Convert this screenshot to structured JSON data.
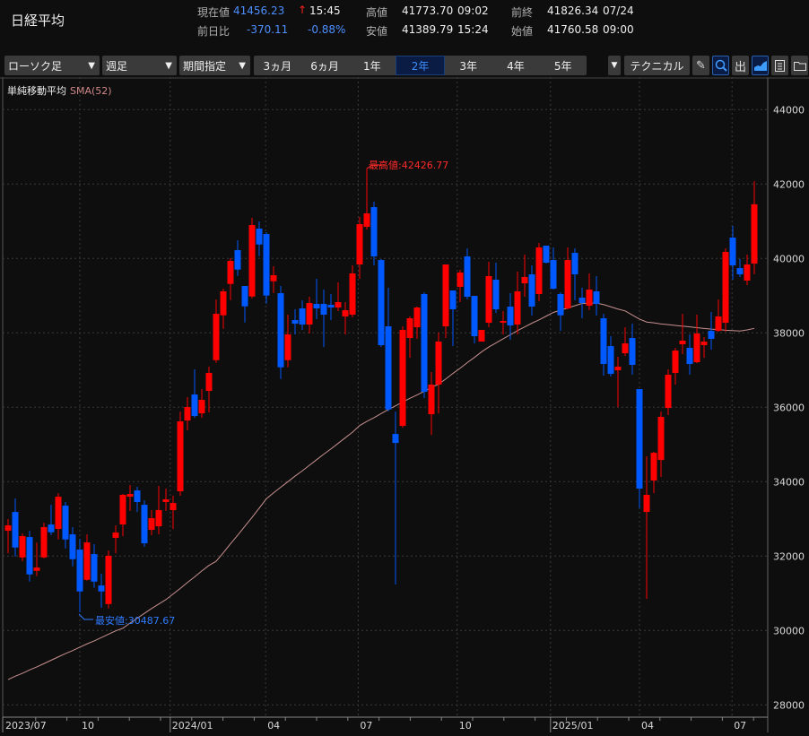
{
  "header": {
    "title": "日経平均",
    "current_label": "現在値",
    "current_value": "41456.23",
    "current_arrow": "↑",
    "current_time": "15:45",
    "high_label": "高値",
    "high_value": "41773.70",
    "high_time": "09:02",
    "prev_close_label": "前終",
    "prev_close_value": "41826.34",
    "prev_close_date": "07/24",
    "change_label": "前日比",
    "change_value": "-370.11",
    "change_pct": "-0.88%",
    "low_label": "安値",
    "low_value": "41389.79",
    "low_time": "15:24",
    "open_label": "始値",
    "open_value": "41760.58",
    "open_time": "09:00"
  },
  "toolbar": {
    "chart_type": "ローソク足",
    "interval": "週足",
    "period_mode": "期間指定",
    "periods": [
      "3ヵ月",
      "6ヵ月",
      "1年",
      "2年",
      "3年",
      "4年",
      "5年"
    ],
    "selected_period": "2年",
    "technical_label": "テクニカル",
    "icons": [
      "pencil-icon",
      "zoom-icon",
      "volume-icon",
      "area-chart-icon",
      "save-icon",
      "folder-icon"
    ]
  },
  "legend": {
    "indicator": "単純移動平均",
    "series": "SMA(52)"
  },
  "colors": {
    "up": "#ff0000",
    "down": "#0058ff",
    "sma": "#c89090",
    "accent": "#3f8cff",
    "background": "#0e0e0e"
  },
  "chart_data": {
    "type": "candlestick",
    "interval": "weekly",
    "y_ticks": [
      28000,
      30000,
      32000,
      34000,
      36000,
      38000,
      40000,
      42000,
      44000
    ],
    "ylim": [
      27600,
      45300
    ],
    "x_tick_labels": [
      "2023/07",
      "10",
      "2024/01",
      "04",
      "07",
      "10",
      "2025/01",
      "04",
      "07"
    ],
    "grid": true,
    "annotations": {
      "high": "最高値:42426.77",
      "low": "最安値:30487.67"
    },
    "ohlc_columns": [
      "open",
      "high",
      "low",
      "close"
    ],
    "candles": [
      [
        32680,
        32994,
        32078,
        32825
      ],
      [
        33186,
        33548,
        31989,
        32230
      ],
      [
        31964,
        32608,
        31861,
        32536
      ],
      [
        32512,
        32680,
        31314,
        31507
      ],
      [
        31603,
        32367,
        31458,
        31692
      ],
      [
        31964,
        32897,
        31940,
        32777
      ],
      [
        32849,
        33379,
        32567,
        32640
      ],
      [
        32729,
        33693,
        32447,
        33596
      ],
      [
        33355,
        33452,
        32206,
        32447
      ],
      [
        32584,
        32777,
        31723,
        31916
      ],
      [
        32174,
        32463,
        30487.67,
        31049
      ],
      [
        31362,
        32584,
        31340,
        32367
      ],
      [
        32054,
        32319,
        31145,
        31314
      ],
      [
        31210,
        31523,
        30615,
        31049
      ],
      [
        30711,
        32151,
        30591,
        32006
      ],
      [
        32488,
        32825,
        32078,
        32632
      ],
      [
        32849,
        33669,
        32536,
        33645
      ],
      [
        33596,
        33910,
        33211,
        33669
      ],
      [
        33765,
        33862,
        33186,
        33452
      ],
      [
        33379,
        33500,
        32247,
        32343
      ],
      [
        32705,
        33235,
        32560,
        33018
      ],
      [
        32801,
        33886,
        32584,
        33235
      ],
      [
        33452,
        33813,
        33211,
        33524
      ],
      [
        33235,
        33621,
        32729,
        33427
      ],
      [
        33741,
        35885,
        33621,
        35620
      ],
      [
        35644,
        36271,
        35379,
        36006
      ],
      [
        36343,
        37018,
        35716,
        35765
      ],
      [
        35837,
        36488,
        35716,
        36199
      ],
      [
        36440,
        37091,
        35861,
        36922
      ],
      [
        37266,
        38898,
        37194,
        38512
      ],
      [
        38472,
        39187,
        38110,
        39115
      ],
      [
        39315,
        40007,
        38881,
        39934
      ],
      [
        40224,
        40489,
        39532,
        39701
      ],
      [
        39260,
        39260,
        38279,
        38713
      ],
      [
        38978,
        41091,
        38930,
        40898
      ],
      [
        40802,
        40995,
        40062,
        40375
      ],
      [
        40657,
        40705,
        38785,
        39002
      ],
      [
        39387,
        39790,
        39074,
        39549
      ],
      [
        39067,
        39260,
        36760,
        37074
      ],
      [
        37266,
        38488,
        37074,
        37958
      ],
      [
        38344,
        38633,
        37958,
        38247
      ],
      [
        38657,
        38874,
        38079,
        38223
      ],
      [
        38223,
        38970,
        37982,
        38802
      ],
      [
        38778,
        39452,
        38368,
        38657
      ],
      [
        38778,
        39163,
        37620,
        38488
      ],
      [
        38754,
        39043,
        38344,
        38681
      ],
      [
        38681,
        39356,
        38585,
        38826
      ],
      [
        38440,
        38826,
        37958,
        38609
      ],
      [
        38488,
        39813,
        38416,
        39597
      ],
      [
        39838,
        41115,
        39452,
        40922
      ],
      [
        40850,
        42426.77,
        40778,
        41212
      ],
      [
        41380,
        41525,
        39814,
        40055
      ],
      [
        39958,
        39983,
        37620,
        37669
      ],
      [
        38175,
        39211,
        35893,
        35941
      ],
      [
        35282,
        35885,
        31240,
        35041
      ],
      [
        35500,
        38175,
        35450,
        38079
      ],
      [
        37862,
        38440,
        37331,
        38392
      ],
      [
        38151,
        38705,
        37838,
        38681
      ],
      [
        39043,
        39091,
        36247,
        36416
      ],
      [
        35813,
        36946,
        35258,
        36609
      ],
      [
        36609,
        38006,
        35837,
        37765
      ],
      [
        38175,
        39838,
        37862,
        39838
      ],
      [
        39139,
        39139,
        37645,
        38633
      ],
      [
        39235,
        39693,
        38826,
        39621
      ],
      [
        40055,
        40272,
        38898,
        38970
      ],
      [
        38994,
        38994,
        37717,
        37910
      ],
      [
        37765,
        38079,
        37765,
        38079
      ],
      [
        38271,
        39910,
        38151,
        39525
      ],
      [
        39428,
        39886,
        38536,
        38633
      ],
      [
        38271,
        38585,
        37958,
        38320
      ],
      [
        38705,
        39067,
        37814,
        38199
      ],
      [
        38223,
        39645,
        37958,
        39115
      ],
      [
        39331,
        40103,
        38970,
        39500
      ],
      [
        39573,
        39813,
        38464,
        38705
      ],
      [
        39043,
        40417,
        38850,
        40296
      ],
      [
        40344,
        40344,
        39862,
        39886
      ],
      [
        39958,
        40296,
        39163,
        39187
      ],
      [
        39043,
        39091,
        38054,
        38472
      ],
      [
        38657,
        40296,
        38633,
        39958
      ],
      [
        40151,
        40272,
        38874,
        39573
      ],
      [
        38946,
        39211,
        38392,
        38802
      ],
      [
        38729,
        39597,
        38609,
        39163
      ],
      [
        39115,
        39525,
        38464,
        38778
      ],
      [
        38392,
        38512,
        36850,
        37163
      ],
      [
        37645,
        37910,
        36826,
        36898
      ],
      [
        36994,
        37356,
        36006,
        37091
      ],
      [
        37452,
        38151,
        37380,
        37717
      ],
      [
        37862,
        38247,
        36874,
        37139
      ],
      [
        36488,
        36488,
        33283,
        33813
      ],
      [
        33187,
        34681,
        30848,
        33645
      ],
      [
        34030,
        34801,
        33693,
        34777
      ],
      [
        34584,
        35885,
        34126,
        35741
      ],
      [
        35982,
        37018,
        35789,
        36874
      ],
      [
        36922,
        37597,
        36609,
        37524
      ],
      [
        37693,
        38512,
        37428,
        37790
      ],
      [
        37597,
        37958,
        36874,
        37163
      ],
      [
        37211,
        38488,
        37187,
        37982
      ],
      [
        37669,
        37886,
        37331,
        37765
      ],
      [
        38054,
        38561,
        37549,
        37838
      ],
      [
        38054,
        38898,
        38030,
        38440
      ],
      [
        38271,
        40272,
        38030,
        40175
      ],
      [
        40561,
        40874,
        39428,
        39814
      ],
      [
        39741,
        39983,
        39500,
        39573
      ],
      [
        39404,
        40103,
        39283,
        39838
      ],
      [
        39862,
        42078,
        39573,
        41456.23
      ]
    ],
    "sma": [
      28680,
      28770,
      28850,
      28940,
      29020,
      29110,
      29200,
      29290,
      29380,
      29460,
      29550,
      29640,
      29720,
      29810,
      29900,
      29990,
      30060,
      30200,
      30330,
      30460,
      30590,
      30710,
      30830,
      30980,
      31130,
      31290,
      31440,
      31600,
      31750,
      31860,
      32090,
      32330,
      32560,
      32800,
      33040,
      33290,
      33540,
      33700,
      33850,
      34000,
      34150,
      34290,
      34440,
      34590,
      34740,
      34880,
      35030,
      35180,
      35330,
      35510,
      35620,
      35720,
      35830,
      35940,
      36040,
      36140,
      36240,
      36330,
      36430,
      36530,
      36620,
      36760,
      36910,
      37050,
      37200,
      37340,
      37490,
      37620,
      37730,
      37840,
      37950,
      38060,
      38160,
      38260,
      38350,
      38450,
      38550,
      38610,
      38670,
      38730,
      38790,
      38800,
      38800,
      38760,
      38700,
      38640,
      38590,
      38480,
      38370,
      38290,
      38270,
      38240,
      38220,
      38200,
      38180,
      38160,
      38140,
      38120,
      38100,
      38090,
      38070,
      38060,
      38050,
      38080,
      38120
    ]
  }
}
